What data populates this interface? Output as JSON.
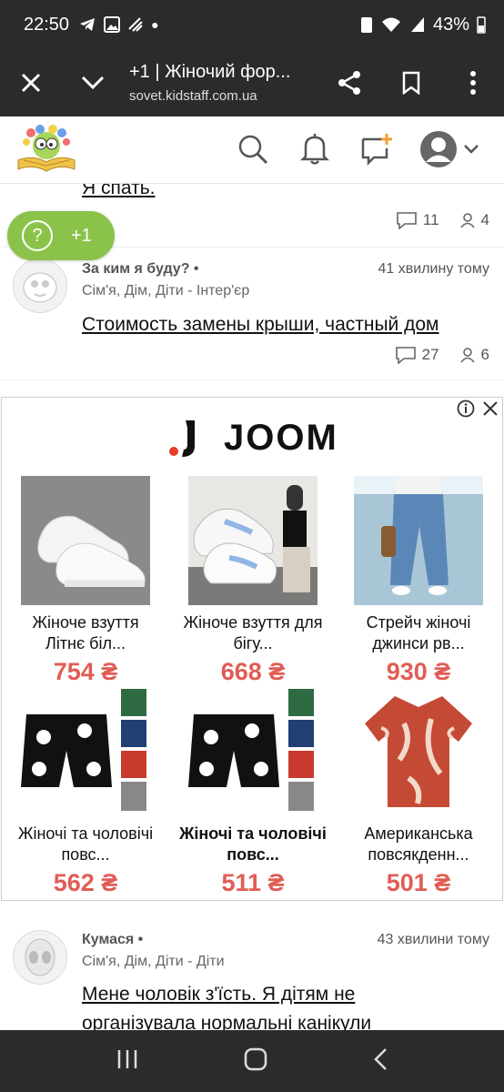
{
  "status_bar": {
    "time": "22:50",
    "battery": "43%"
  },
  "browser": {
    "title": "+1 | Жіночий фор...",
    "url": "sovet.kidstaff.com.ua"
  },
  "plus_button": {
    "label": "+1"
  },
  "posts": [
    {
      "title": "Я спать.",
      "comments": "11",
      "users": "4"
    },
    {
      "author": "За ким я буду?",
      "ago": "41 хвилину тому",
      "category": "Сім'я, Дім, Діти - Інтер'єр",
      "title": "Стоимость замены крыши, частный дом",
      "comments": "27",
      "users": "6"
    },
    {
      "author": "Кумася",
      "ago": "43 хвилини тому",
      "category": "Сім'я, Дім, Діти - Діти",
      "title": "Мене чоловік з'їсть. Я дітям не",
      "title2": "організувала нормальні канікули"
    }
  ],
  "ad": {
    "brand": "JOOM",
    "products": [
      {
        "name1": "Жіноче взуття",
        "name2": "Літнє біл...",
        "price": "754 ₴",
        "image": "white-sneakers"
      },
      {
        "name1": "Жіноче взуття для",
        "name2": "бігу...",
        "price": "668 ₴",
        "image": "white-blue-sneakers"
      },
      {
        "name1": "Стрейч жіночі",
        "name2": "джинси рв...",
        "price": "930 ₴",
        "image": "ripped-jeans"
      },
      {
        "name1": "Жіночі та чоловічі",
        "name2": "повс...",
        "price": "562 ₴",
        "image": "flower-shorts"
      },
      {
        "name1": "Жіночі та чоловічі",
        "name2": "повс...",
        "price": "511 ₴",
        "image": "flower-shorts"
      },
      {
        "name1": "Американська",
        "name2": "повсякденн...",
        "price": "501 ₴",
        "image": "hawaiian-shirt"
      }
    ]
  },
  "colors": {
    "accent": "#8bc34a",
    "price": "#e05d55",
    "bar": "#2b2b2b"
  }
}
